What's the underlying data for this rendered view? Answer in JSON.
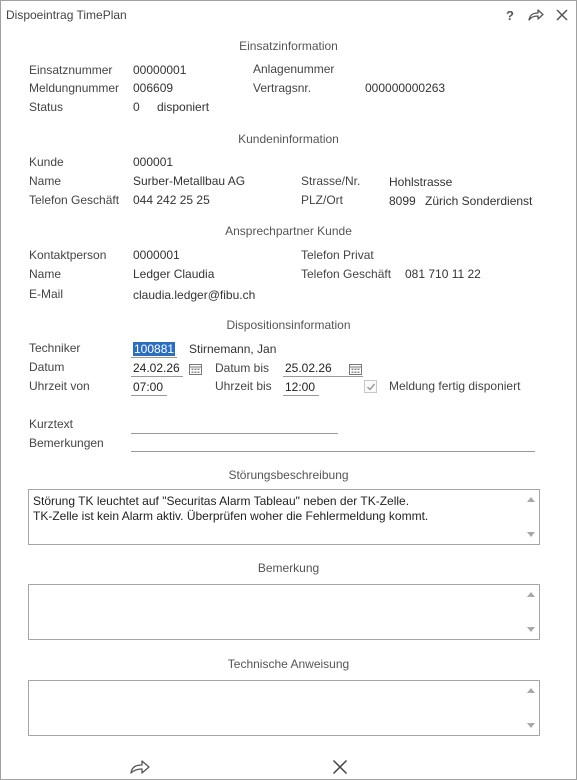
{
  "window": {
    "title": "Dispoeintrag TimePlan",
    "help_glyph": "?"
  },
  "einsatz": {
    "heading": "Einsatzinformation",
    "einsatznummer_label": "Einsatznummer",
    "einsatznummer_value": "00000001",
    "anlagennummer_label": "Anlagenummer",
    "anlagennummer_value": "",
    "meldungnummer_label": "Meldungnummer",
    "meldungnummer_value": "006609",
    "vertragsnr_label": "Vertragsnr.",
    "vertragsnr_value": "000000000263",
    "status_label": "Status",
    "status_code": "0",
    "status_text": "disponiert"
  },
  "kunde": {
    "heading": "Kundeninformation",
    "kunde_label": "Kunde",
    "kunde_value": "000001",
    "name_label": "Name",
    "name_value": "Surber-Metallbau AG",
    "strasse_label": "Strasse/Nr.",
    "strasse_value": "Hohlstrasse",
    "telefon_label": "Telefon Geschäft",
    "telefon_value": "044 242 25 25",
    "plz_label": "PLZ/Ort",
    "plz_value": "8099",
    "ort_value": "Zürich Sonderdienst"
  },
  "ansprechpartner": {
    "heading": "Ansprechpartner Kunde",
    "kontakt_label": "Kontaktperson",
    "kontakt_value": "0000001",
    "tel_privat_label": "Telefon Privat",
    "tel_privat_value": "",
    "name_label": "Name",
    "name_value": "Ledger Claudia",
    "tel_geschaeft_label": "Telefon Geschäft",
    "tel_geschaeft_value": "081 710 11 22",
    "email_label": "E-Mail",
    "email_value": "claudia.ledger@fibu.ch"
  },
  "dispo": {
    "heading": "Dispositionsinformation",
    "techniker_label": "Techniker",
    "techniker_value": "100881",
    "techniker_name": "Stirnemann, Jan",
    "datum_label": "Datum",
    "datum_value": "24.02.26",
    "datum_bis_label": "Datum bis",
    "datum_bis_value": "25.02.26",
    "uhrzeit_von_label": "Uhrzeit von",
    "uhrzeit_von_value": "07:00",
    "uhrzeit_bis_label": "Uhrzeit bis",
    "uhrzeit_bis_value": "12:00",
    "fertig_label": "Meldung fertig disponiert",
    "fertig_checked": true,
    "kurztext_label": "Kurztext",
    "kurztext_value": "",
    "bemerkungen_label": "Bemerkungen",
    "bemerkungen_value": ""
  },
  "stoerung": {
    "heading": "Störungsbeschreibung",
    "text": "Störung TK leuchtet auf \"Securitas Alarm Tableau\" neben der TK-Zelle.\nTK-Zelle ist kein Alarm aktiv. Überprüfen woher die Fehlermeldung kommt."
  },
  "bemerkung": {
    "heading": "Bemerkung",
    "text": ""
  },
  "anweisung": {
    "heading": "Technische Anweisung",
    "text": ""
  },
  "colors": {
    "selection": "#2b6cc4",
    "border": "#a6a6a6",
    "icon": "#555555"
  }
}
